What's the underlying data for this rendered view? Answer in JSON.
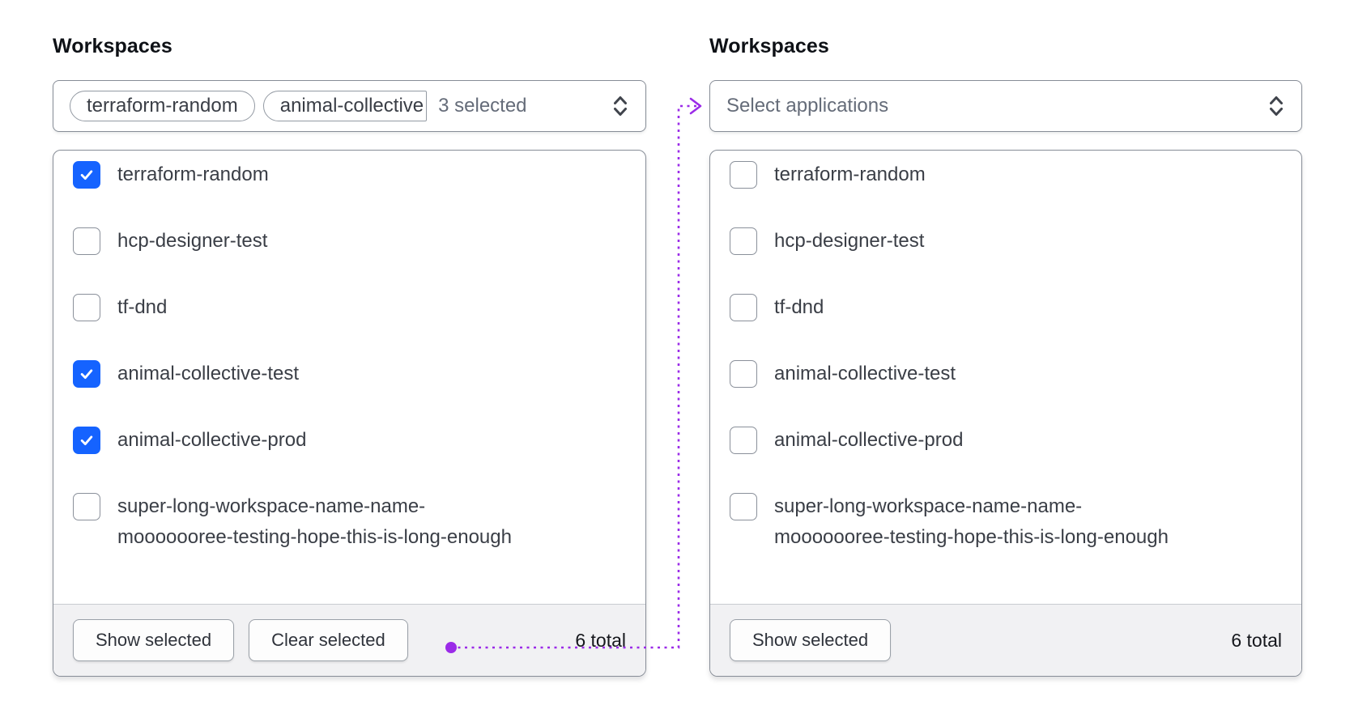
{
  "colors": {
    "checkbox_checked_blue": "#1563ff",
    "arrow_purple": "#9b2be8",
    "border_gray": "#878d97",
    "footer_bg": "#f1f1f3"
  },
  "left": {
    "label": "Workspaces",
    "trigger": {
      "tags": [
        "terraform-random",
        "animal-collective"
      ],
      "selected_count_text": "3 selected",
      "chevron_icon": "unfold-chevron-icon"
    },
    "items": [
      {
        "label": "terraform-random",
        "checked": true
      },
      {
        "label": "hcp-designer-test",
        "checked": false
      },
      {
        "label": "tf-dnd",
        "checked": false
      },
      {
        "label": "animal-collective-test",
        "checked": true
      },
      {
        "label": "animal-collective-prod",
        "checked": true
      },
      {
        "label": "super-long-workspace-name-name-\nmooooooree-testing-hope-this-is-long-enough",
        "checked": false
      }
    ],
    "footer": {
      "buttons": [
        "Show selected",
        "Clear selected"
      ],
      "total_text": "6 total"
    }
  },
  "right": {
    "label": "Workspaces",
    "trigger": {
      "placeholder": "Select applications",
      "chevron_icon": "unfold-chevron-icon"
    },
    "items": [
      {
        "label": "terraform-random",
        "checked": false
      },
      {
        "label": "hcp-designer-test",
        "checked": false
      },
      {
        "label": "tf-dnd",
        "checked": false
      },
      {
        "label": "animal-collective-test",
        "checked": false
      },
      {
        "label": "animal-collective-prod",
        "checked": false
      },
      {
        "label": "super-long-workspace-name-name-\nmooooooree-testing-hope-this-is-long-enough",
        "checked": false
      }
    ],
    "footer": {
      "buttons": [
        "Show selected"
      ],
      "total_text": "6 total"
    }
  }
}
